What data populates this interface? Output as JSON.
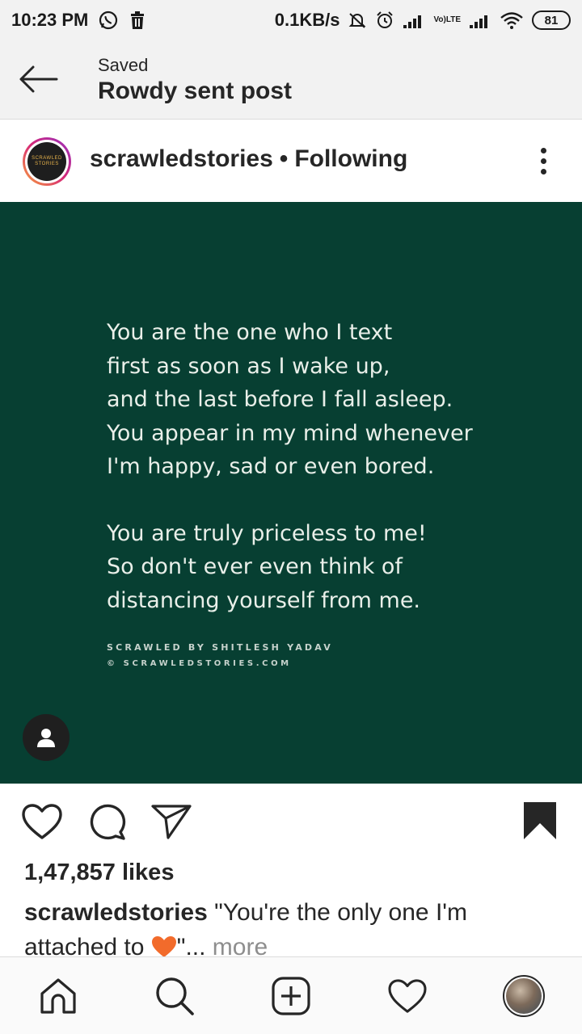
{
  "status_bar": {
    "time": "10:23 PM",
    "net_speed": "0.1KB/s",
    "carrier_badge_top": "Vo)",
    "carrier_badge_bottom": "LTE",
    "battery": "81",
    "icons": [
      "whatsapp-icon",
      "delete-icon",
      "mute-alarm-icon",
      "alarm-icon",
      "signal-icon",
      "signal-icon-2",
      "wifi-icon",
      "battery-icon"
    ]
  },
  "header": {
    "subtitle": "Saved",
    "title": "Rowdy sent post",
    "back_icon": "back-arrow-icon"
  },
  "post": {
    "avatar_text_top": "SCRAWLED",
    "avatar_text_bottom": "STORIES",
    "username": "scrawledstories",
    "separator": "•",
    "follow_state": "Following",
    "more_icon": "more-vertical-icon",
    "image": {
      "background": "#073f32",
      "lines": [
        "You are the one who I text",
        "first as soon as I wake up,",
        "and the last before I fall asleep.",
        "You appear in my mind whenever",
        "I'm happy, sad or even bored.",
        "You are truly priceless to me!",
        "So don't ever even think of",
        "distancing yourself from me."
      ],
      "credit": "SCRAWLED BY SHITLESH YADAV",
      "copyright": "© SCRAWLEDSTORIES.COM"
    },
    "likes": "1,47,857 likes",
    "caption_user": "scrawledstories",
    "caption_text_1": "\"You're the only one I'm attached to",
    "caption_text_2": "\"...",
    "caption_more": "more",
    "heart_color": "#f26b2b"
  },
  "actions": {
    "like_icon": "heart-outline-icon",
    "comment_icon": "comment-icon",
    "share_icon": "send-icon",
    "save_icon": "bookmark-filled-icon"
  },
  "bottom_nav": {
    "items": [
      "home-icon",
      "search-icon",
      "add-post-icon",
      "activity-heart-icon",
      "profile-avatar"
    ]
  }
}
